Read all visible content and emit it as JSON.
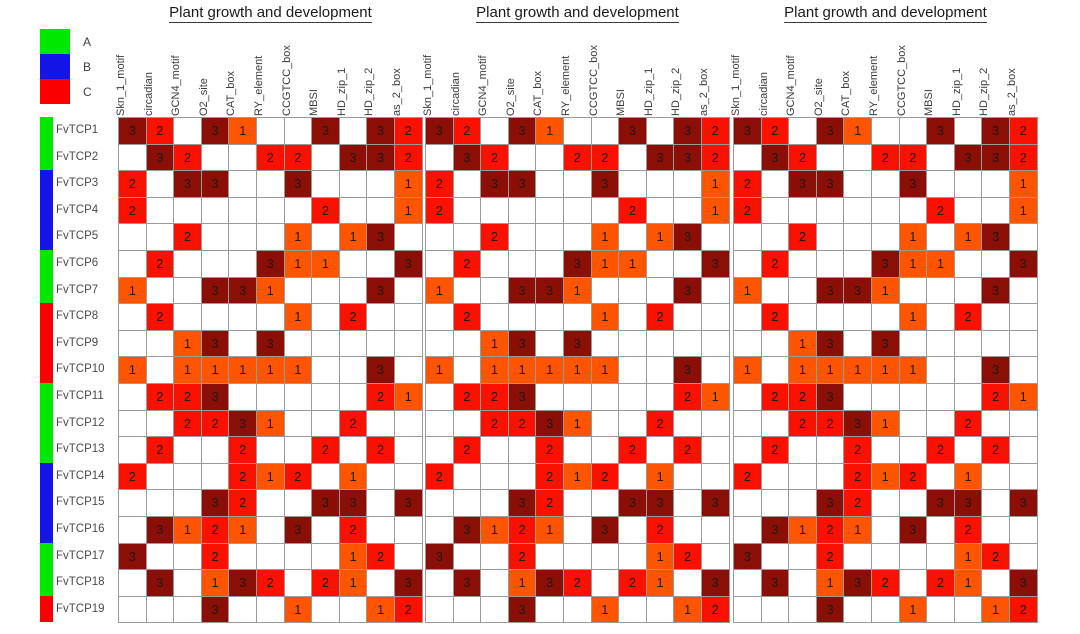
{
  "legend": [
    {
      "label": "A",
      "color": "#00e800"
    },
    {
      "label": "B",
      "color": "#1414e6"
    },
    {
      "label": "C",
      "color": "#fa0000"
    }
  ],
  "value_colors": {
    "0": "#ffffff",
    "1": "#ff5500",
    "2": "#fa1100",
    "3": "#8b0f07"
  },
  "row_groups": [
    {
      "group": "A",
      "color": "#00e800",
      "start": 0,
      "end": 1
    },
    {
      "group": "B",
      "color": "#1414e6",
      "start": 2,
      "end": 4
    },
    {
      "group": "A",
      "color": "#00e800",
      "start": 5,
      "end": 6
    },
    {
      "group": "C",
      "color": "#fa0000",
      "start": 7,
      "end": 9
    },
    {
      "group": "A",
      "color": "#00e800",
      "start": 10,
      "end": 12
    },
    {
      "group": "B",
      "color": "#1414e6",
      "start": 13,
      "end": 15
    },
    {
      "group": "A",
      "color": "#00e800",
      "start": 16,
      "end": 17
    },
    {
      "group": "C",
      "color": "#fa0000",
      "start": 18,
      "end": 18
    }
  ],
  "panels": [
    {
      "title": "Plant growth and development"
    },
    {
      "title": "Plant growth and development"
    },
    {
      "title": "Plant growth and development"
    }
  ],
  "chart_data": {
    "type": "heatmap",
    "title": "Plant growth and development",
    "xlabel": "",
    "ylabel": "",
    "grid": true,
    "legend_position": "top-left",
    "colorscale": {
      "0": "#ffffff",
      "1": "#ff5500",
      "2": "#fa1100",
      "3": "#8b0f07"
    },
    "value_range": [
      0,
      3
    ],
    "categories": [
      "Skn_1_motif",
      "circadian",
      "GCN4_motif",
      "O2_site",
      "CAT_box",
      "RY_element",
      "CCGTCC_box",
      "MBSI",
      "HD_zip_1",
      "HD_zip_2",
      "as_2_box"
    ],
    "rows": [
      "FvTCP1",
      "FvTCP2",
      "FvTCP3",
      "FvTCP4",
      "FvTCP5",
      "FvTCP6",
      "FvTCP7",
      "FvTCP8",
      "FvTCP9",
      "FvTCP10",
      "FvTCP11",
      "FvTCP12",
      "FvTCP13",
      "FvTCP14",
      "FvTCP15",
      "FvTCP16",
      "FvTCP17",
      "FvTCP18",
      "FvTCP19"
    ],
    "values": [
      [
        3,
        2,
        0,
        3,
        1,
        0,
        0,
        3,
        0,
        3,
        2
      ],
      [
        0,
        3,
        2,
        0,
        0,
        2,
        2,
        0,
        3,
        3,
        2
      ],
      [
        2,
        0,
        3,
        3,
        0,
        0,
        3,
        0,
        0,
        0,
        1
      ],
      [
        2,
        0,
        0,
        0,
        0,
        0,
        0,
        2,
        0,
        0,
        1
      ],
      [
        0,
        0,
        2,
        0,
        0,
        0,
        1,
        0,
        1,
        3,
        0
      ],
      [
        0,
        2,
        0,
        0,
        0,
        3,
        1,
        1,
        0,
        0,
        3
      ],
      [
        1,
        0,
        0,
        3,
        3,
        1,
        0,
        0,
        0,
        3,
        0
      ],
      [
        0,
        2,
        0,
        0,
        0,
        0,
        1,
        0,
        2,
        0,
        0
      ],
      [
        0,
        0,
        1,
        3,
        0,
        3,
        0,
        0,
        0,
        0,
        0
      ],
      [
        1,
        0,
        1,
        1,
        1,
        1,
        1,
        0,
        0,
        3,
        0
      ],
      [
        0,
        2,
        2,
        3,
        0,
        0,
        0,
        0,
        0,
        2,
        1
      ],
      [
        0,
        0,
        2,
        2,
        3,
        1,
        0,
        0,
        2,
        0,
        0
      ],
      [
        0,
        2,
        0,
        0,
        2,
        0,
        0,
        2,
        0,
        2,
        0
      ],
      [
        2,
        0,
        0,
        0,
        2,
        1,
        2,
        0,
        1,
        0,
        0
      ],
      [
        0,
        0,
        0,
        3,
        2,
        0,
        0,
        3,
        3,
        0,
        3
      ],
      [
        0,
        3,
        1,
        2,
        1,
        0,
        3,
        0,
        2,
        0,
        0
      ],
      [
        3,
        0,
        0,
        2,
        0,
        0,
        0,
        0,
        1,
        2,
        0
      ],
      [
        0,
        3,
        0,
        1,
        3,
        2,
        0,
        2,
        1,
        0,
        3
      ],
      [
        0,
        0,
        0,
        3,
        0,
        0,
        1,
        0,
        0,
        1,
        2
      ]
    ],
    "panel_count": 3,
    "panel_titles": [
      "Plant growth and development",
      "Plant growth and development",
      "Plant growth and development"
    ],
    "row_group_legend": [
      {
        "label": "A",
        "color": "#00e800"
      },
      {
        "label": "B",
        "color": "#1414e6"
      },
      {
        "label": "C",
        "color": "#fa0000"
      }
    ]
  }
}
